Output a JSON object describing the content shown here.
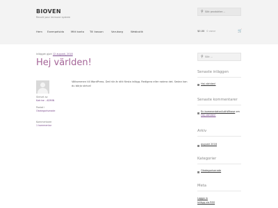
{
  "header": {
    "site_title": "BIOVEN",
    "site_description": "Revolt your immune system",
    "search_placeholder": "Sök produkter…",
    "nav": [
      "Hem",
      "Exempelsida",
      "Mitt konto",
      "Till kassan",
      "Varukorg",
      "Webbutik"
    ],
    "cart_total": "$0.00",
    "cart_count": "0 varor",
    "icons": {
      "search": "search-icon",
      "cart": "cart-icon"
    }
  },
  "post": {
    "meta_prefix": "Inlägget gjort",
    "meta_date": "12 augusti, 2018",
    "title": "Hej världen!",
    "written_by_label": "Skrivet av",
    "author": "Katrine - ADMIN",
    "posted_in_label": "Postat i",
    "category": "Okategoriserade",
    "comments_label": "Kommentarer",
    "comments_link": "1 kommentar",
    "body": "Välkommen till WordPress. Det här är ditt första inlägg. Redigera eller radera det. Sedan kan du börja skriva!"
  },
  "sidebar": {
    "search_placeholder": "Sök …",
    "recent_posts_title": "Senaste inläggen",
    "recent_posts": [
      "Hej världen!"
    ],
    "recent_comments_title": "Senaste kommentarer",
    "recent_comment_author": "En kommentatorAuthWhose",
    "recent_comment_on": "om",
    "recent_comment_post": "Hej världen!",
    "archive_title": "Arkiv",
    "archive": [
      "augusti 2018"
    ],
    "categories_title": "Kategorier",
    "categories": [
      "Okategoriserade"
    ],
    "meta_title": "Meta",
    "meta_links": [
      "Logga in",
      "Inlägg via RSS"
    ]
  },
  "colors": {
    "accent": "#a46497",
    "header_bg": "#f3f3f3"
  }
}
